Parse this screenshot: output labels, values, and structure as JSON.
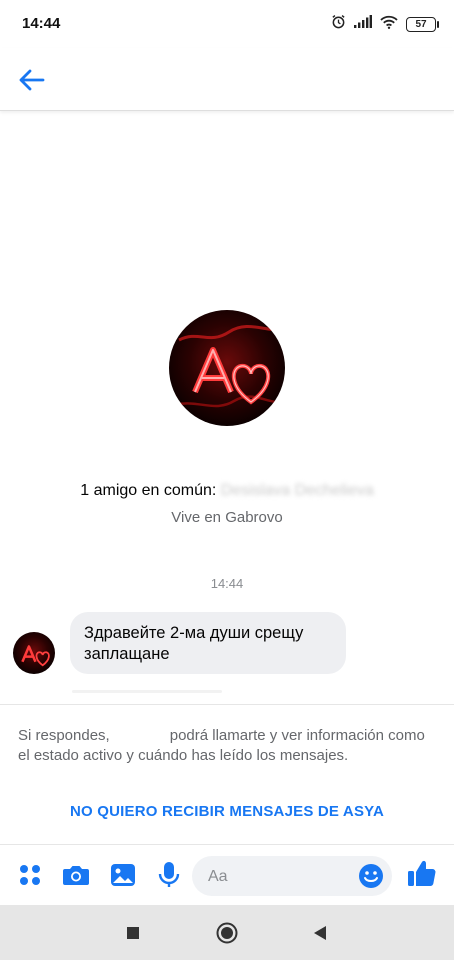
{
  "status_bar": {
    "time": "14:44",
    "battery": "57"
  },
  "app_bar": {
    "back_icon": "arrow-left-icon"
  },
  "profile": {
    "mutual_prefix": "1 amigo en común: ",
    "mutual_name_obscured": "Desislava Dechelieva",
    "lives": "Vive en Gabrovo"
  },
  "conversation": {
    "timestamp": "14:44",
    "messages": [
      {
        "line1": "Здравейте  2-ма души срещу",
        "line2": "заплащане"
      }
    ]
  },
  "notice": {
    "part1": "Si respondes,",
    "part2": "podrá llamarte y ver información como el estado activo y cuándo has leído los mensajes."
  },
  "block_link": "NO QUIERO RECIBIR MENSAJES DE ASYA",
  "composer": {
    "placeholder": "Aa",
    "icons": [
      "apps-icon",
      "camera-icon",
      "gallery-icon",
      "microphone-icon",
      "emoji-icon",
      "thumbs-up-icon"
    ]
  },
  "nav_bar": {
    "icons": [
      "recents-square-icon",
      "home-circle-icon",
      "back-triangle-icon"
    ]
  },
  "colors": {
    "accent": "#1877f2",
    "bubble": "#eeeff2",
    "secondary_text": "#65676b"
  }
}
